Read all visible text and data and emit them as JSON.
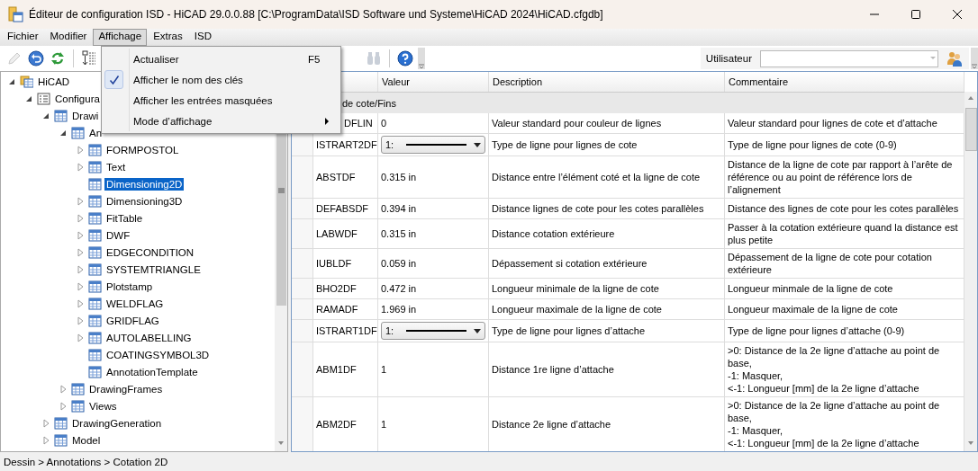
{
  "window": {
    "title": "Éditeur de configuration ISD  - HiCAD 29.0.0.88 [C:\\ProgramData\\ISD Software und Systeme\\HiCAD 2024\\HiCAD.cfgdb]"
  },
  "menubar": [
    {
      "label": "Fichier",
      "selected": false
    },
    {
      "label": "Modifier",
      "selected": false
    },
    {
      "label": "Affichage",
      "selected": true
    },
    {
      "label": "Extras",
      "selected": false
    },
    {
      "label": "ISD",
      "selected": false
    }
  ],
  "dropdown_menu": [
    {
      "label": "Actualiser",
      "shortcut": "F5",
      "checked": false,
      "submenu": false
    },
    {
      "label": "Afficher le nom des clés",
      "checked": true,
      "submenu": false
    },
    {
      "label": "Afficher les entrées masquées",
      "checked": false,
      "submenu": false
    },
    {
      "label": "Mode d’affichage",
      "checked": false,
      "submenu": true
    }
  ],
  "toolbar": {
    "user_label": "Utilisateur"
  },
  "tree": [
    {
      "label": "HiCAD",
      "kind": "root",
      "expanded": true,
      "selected": false,
      "children": [
        {
          "label": "Configura",
          "kind": "list",
          "expanded": true,
          "selected": false,
          "children": [
            {
              "label": "Drawi",
              "kind": "table",
              "expanded": true,
              "selected": false,
              "children": [
                {
                  "label": "An",
                  "kind": "table",
                  "expanded": true,
                  "selected": false,
                  "children": [
                    {
                      "label": "FORMPOSTOL",
                      "kind": "table",
                      "expanded": false,
                      "selected": false
                    },
                    {
                      "label": "Text",
                      "kind": "table",
                      "expanded": false,
                      "selected": false
                    },
                    {
                      "label": "Dimensioning2D",
                      "kind": "table",
                      "selected": true
                    },
                    {
                      "label": "Dimensioning3D",
                      "kind": "table",
                      "expanded": false,
                      "selected": false
                    },
                    {
                      "label": "FitTable",
                      "kind": "table",
                      "expanded": false,
                      "selected": false
                    },
                    {
                      "label": "DWF",
                      "kind": "table",
                      "expanded": false,
                      "selected": false
                    },
                    {
                      "label": "EDGECONDITION",
                      "kind": "table",
                      "expanded": false,
                      "selected": false
                    },
                    {
                      "label": "SYSTEMTRIANGLE",
                      "kind": "table",
                      "expanded": false,
                      "selected": false
                    },
                    {
                      "label": "Plotstamp",
                      "kind": "table",
                      "expanded": false,
                      "selected": false
                    },
                    {
                      "label": "WELDFLAG",
                      "kind": "table",
                      "expanded": false,
                      "selected": false
                    },
                    {
                      "label": "GRIDFLAG",
                      "kind": "table",
                      "expanded": false,
                      "selected": false
                    },
                    {
                      "label": "AUTOLABELLING",
                      "kind": "table",
                      "expanded": false,
                      "selected": false
                    },
                    {
                      "label": "COATINGSYMBOL3D",
                      "kind": "table",
                      "selected": false
                    },
                    {
                      "label": "AnnotationTemplate",
                      "kind": "table",
                      "selected": false
                    }
                  ]
                },
                {
                  "label": "DrawingFrames",
                  "kind": "table",
                  "expanded": false,
                  "selected": false
                },
                {
                  "label": "Views",
                  "kind": "table",
                  "expanded": false,
                  "selected": false
                }
              ]
            },
            {
              "label": "DrawingGeneration",
              "kind": "table",
              "expanded": false,
              "selected": false
            },
            {
              "label": "Model",
              "kind": "table",
              "expanded": false,
              "selected": false
            }
          ]
        }
      ]
    }
  ],
  "table": {
    "columns": [
      "Valeur",
      "Description",
      "Commentaire"
    ],
    "group": "de cote/Fins",
    "rows": [
      {
        "key": "DFLIN",
        "kind": "text",
        "value": "0",
        "description": "Valeur standard pour couleur de lignes",
        "comment": "Valeur standard pour lignes de cote et d’attache"
      },
      {
        "key": "ISTRART2DF",
        "kind": "linetype",
        "value": "1:",
        "description": "Type de ligne pour lignes de cote",
        "comment": "Type de ligne pour lignes de cote (0-9)"
      },
      {
        "key": "ABSTDF",
        "kind": "text",
        "value": "0.315 in",
        "description": "Distance entre l’élément coté et la ligne de cote",
        "comment": "Distance de la ligne de cote par rapport à l’arête de référence ou au point de référence lors de l’alignement"
      },
      {
        "key": "DEFABSDF",
        "kind": "text",
        "value": "0.394 in",
        "description": "Distance lignes de cote pour les cotes parallèles",
        "comment": "Distance des lignes de cote pour les cotes parallèles"
      },
      {
        "key": "LABWDF",
        "kind": "text",
        "value": "0.315 in",
        "description": "Distance cotation extérieure",
        "comment": "Passer à la cotation extérieure quand la distance est plus petite"
      },
      {
        "key": "IUBLDF",
        "kind": "text",
        "value": "0.059 in",
        "description": "Dépassement si cotation extérieure",
        "comment": "Dépassement de la ligne de cote pour cotation extérieure"
      },
      {
        "key": "BHO2DF",
        "kind": "text",
        "value": "0.472 in",
        "description": "Longueur minimale de la ligne de cote",
        "comment": "Longueur minmale de la ligne de cote"
      },
      {
        "key": "RAMADF",
        "kind": "text",
        "value": "1.969 in",
        "description": "Longueur maximale de la ligne de cote",
        "comment": "Longueur maximale de la ligne de cote"
      },
      {
        "key": "ISTRART1DF",
        "kind": "linetype",
        "value": "1:",
        "description": "Type de ligne pour lignes d’attache",
        "comment": "Type de ligne pour lignes d’attache (0-9)"
      },
      {
        "key": "ABM1DF",
        "kind": "text",
        "value": "1",
        "description": "Distance 1re ligne d’attache",
        "comment": ">0: Distance de la 2e ligne d’attache au point de base,\n-1: Masquer,\n<-1: Longueur [mm] de la 2e ligne d’attache"
      },
      {
        "key": "ABM2DF",
        "kind": "text",
        "value": "1",
        "description": "Distance 2e ligne d’attache",
        "comment": ">0: Distance de la 2e ligne d’attache au point de base,\n-1: Masquer,\n<-1: Longueur [mm] de la 2e ligne d’attache"
      }
    ]
  },
  "status_bar": "Dessin > Annotations > Cotation 2D"
}
